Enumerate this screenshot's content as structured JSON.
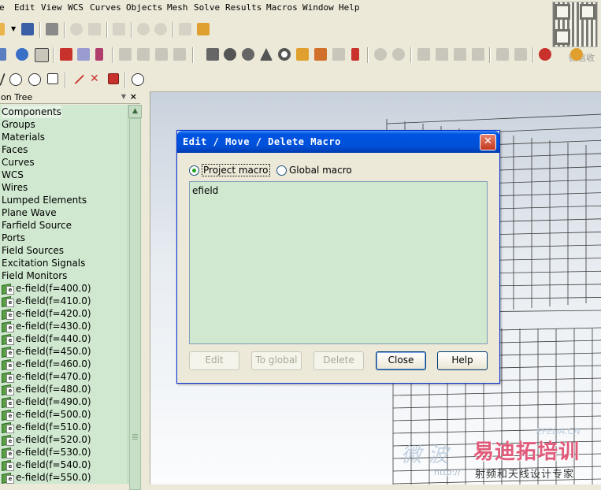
{
  "menubar": {
    "items": [
      "e",
      "Edit",
      "View",
      "WCS",
      "Curves",
      "Objects",
      "Mesh",
      "Solve",
      "Results",
      "Macros",
      "Window",
      "Help"
    ]
  },
  "watermark_top": "微信收",
  "tree": {
    "title": "on Tree",
    "close_label": "×",
    "items": [
      {
        "label": "Components",
        "type": "folder"
      },
      {
        "label": "Groups",
        "type": "folder"
      },
      {
        "label": "Materials",
        "type": "folder"
      },
      {
        "label": "Faces",
        "type": "folder"
      },
      {
        "label": "Curves",
        "type": "folder"
      },
      {
        "label": "WCS",
        "type": "folder"
      },
      {
        "label": "Wires",
        "type": "folder"
      },
      {
        "label": "Lumped Elements",
        "type": "folder"
      },
      {
        "label": "Plane Wave",
        "type": "folder"
      },
      {
        "label": "Farfield Source",
        "type": "folder"
      },
      {
        "label": "Ports",
        "type": "folder"
      },
      {
        "label": "Field Sources",
        "type": "folder"
      },
      {
        "label": "Excitation Signals",
        "type": "folder"
      },
      {
        "label": "Field Monitors",
        "type": "folder"
      },
      {
        "label": "e-field(f=400.0)",
        "type": "monitor"
      },
      {
        "label": "e-field(f=410.0)",
        "type": "monitor"
      },
      {
        "label": "e-field(f=420.0)",
        "type": "monitor"
      },
      {
        "label": "e-field(f=430.0)",
        "type": "monitor"
      },
      {
        "label": "e-field(f=440.0)",
        "type": "monitor"
      },
      {
        "label": "e-field(f=450.0)",
        "type": "monitor"
      },
      {
        "label": "e-field(f=460.0)",
        "type": "monitor"
      },
      {
        "label": "e-field(f=470.0)",
        "type": "monitor"
      },
      {
        "label": "e-field(f=480.0)",
        "type": "monitor"
      },
      {
        "label": "e-field(f=490.0)",
        "type": "monitor"
      },
      {
        "label": "e-field(f=500.0)",
        "type": "monitor"
      },
      {
        "label": "e-field(f=510.0)",
        "type": "monitor"
      },
      {
        "label": "e-field(f=520.0)",
        "type": "monitor"
      },
      {
        "label": "e-field(f=530.0)",
        "type": "monitor"
      },
      {
        "label": "e-field(f=540.0)",
        "type": "monitor"
      },
      {
        "label": "e-field(f=550.0)",
        "type": "monitor"
      }
    ]
  },
  "dialog": {
    "title": "Edit / Move / Delete Macro",
    "close_label": "✕",
    "radio_project": "Project macro",
    "radio_global": "Global macro",
    "selected_scope": "project",
    "macros": [
      "efield"
    ],
    "buttons": {
      "edit": "Edit",
      "to_global": "To global",
      "delete": "Delete",
      "close": "Close",
      "help": "Help"
    }
  },
  "watermark_bottom": {
    "efeda": "EFEDA.CN",
    "logo": "易迪拓培训",
    "ghost": "微 波",
    "url": "http://",
    "sub": "射频和天线设计专家"
  },
  "colors": {
    "tree_bg": "#cfe8cf",
    "dialog_title": "#0054e3",
    "chrome": "#ece9d8"
  }
}
